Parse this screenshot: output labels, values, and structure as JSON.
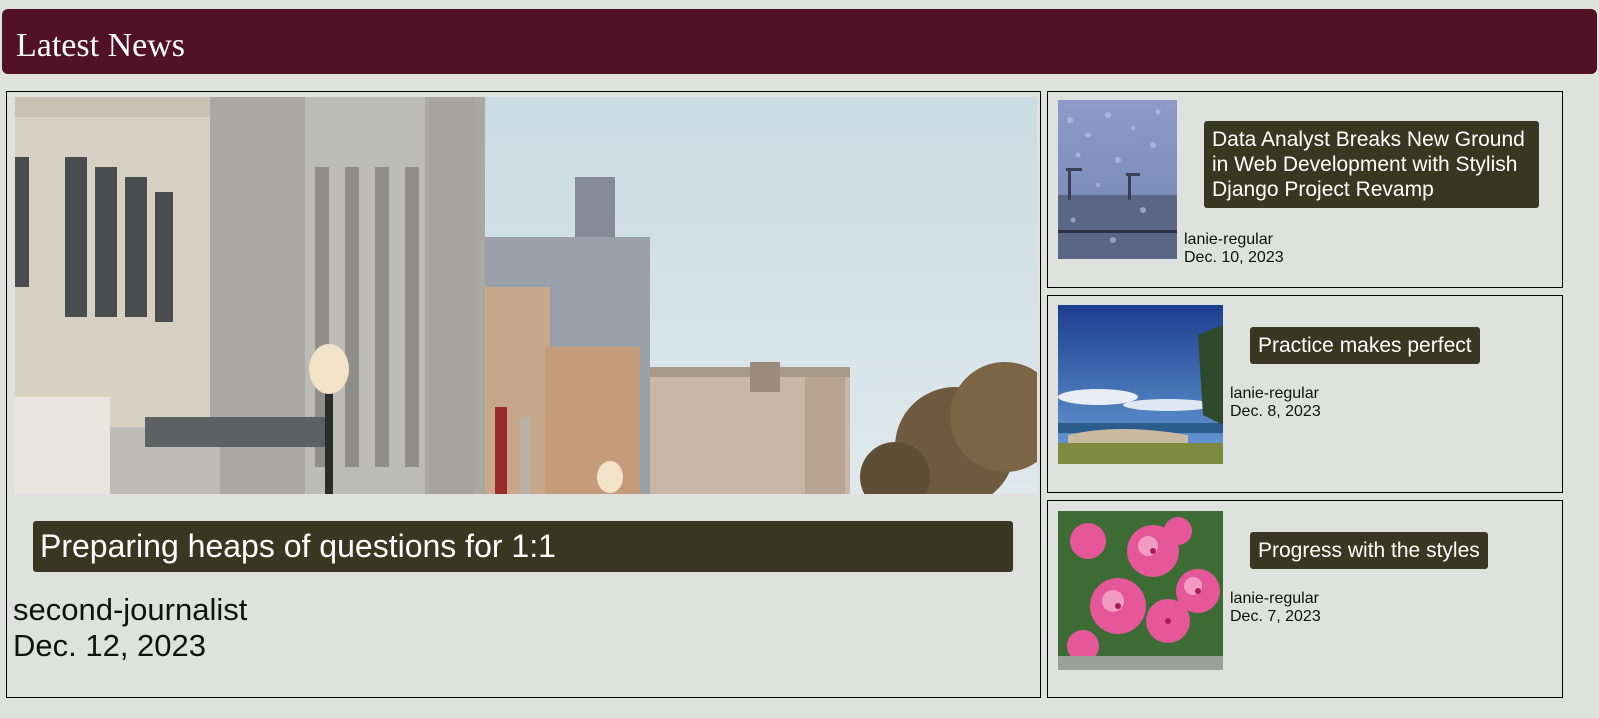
{
  "header": {
    "title": "Latest News"
  },
  "featured": {
    "title": "Preparing heaps of questions for 1:1",
    "author": "second-journalist",
    "date": "Dec. 12, 2023",
    "image_alt": "street with heritage buildings"
  },
  "articles": [
    {
      "title": "Data Analyst Breaks New Ground in Web Development with Stylish Django Project Revamp",
      "author": "lanie-regular",
      "date": "Dec. 10, 2023",
      "image_alt": "harbour cranes through rainy window"
    },
    {
      "title": "Practice makes perfect",
      "author": "lanie-regular",
      "date": "Dec. 8, 2023",
      "image_alt": "coastal park under blue sky"
    },
    {
      "title": "Progress with the styles",
      "author": "lanie-regular",
      "date": "Dec. 7, 2023",
      "image_alt": "pink geranium flowers"
    }
  ]
}
